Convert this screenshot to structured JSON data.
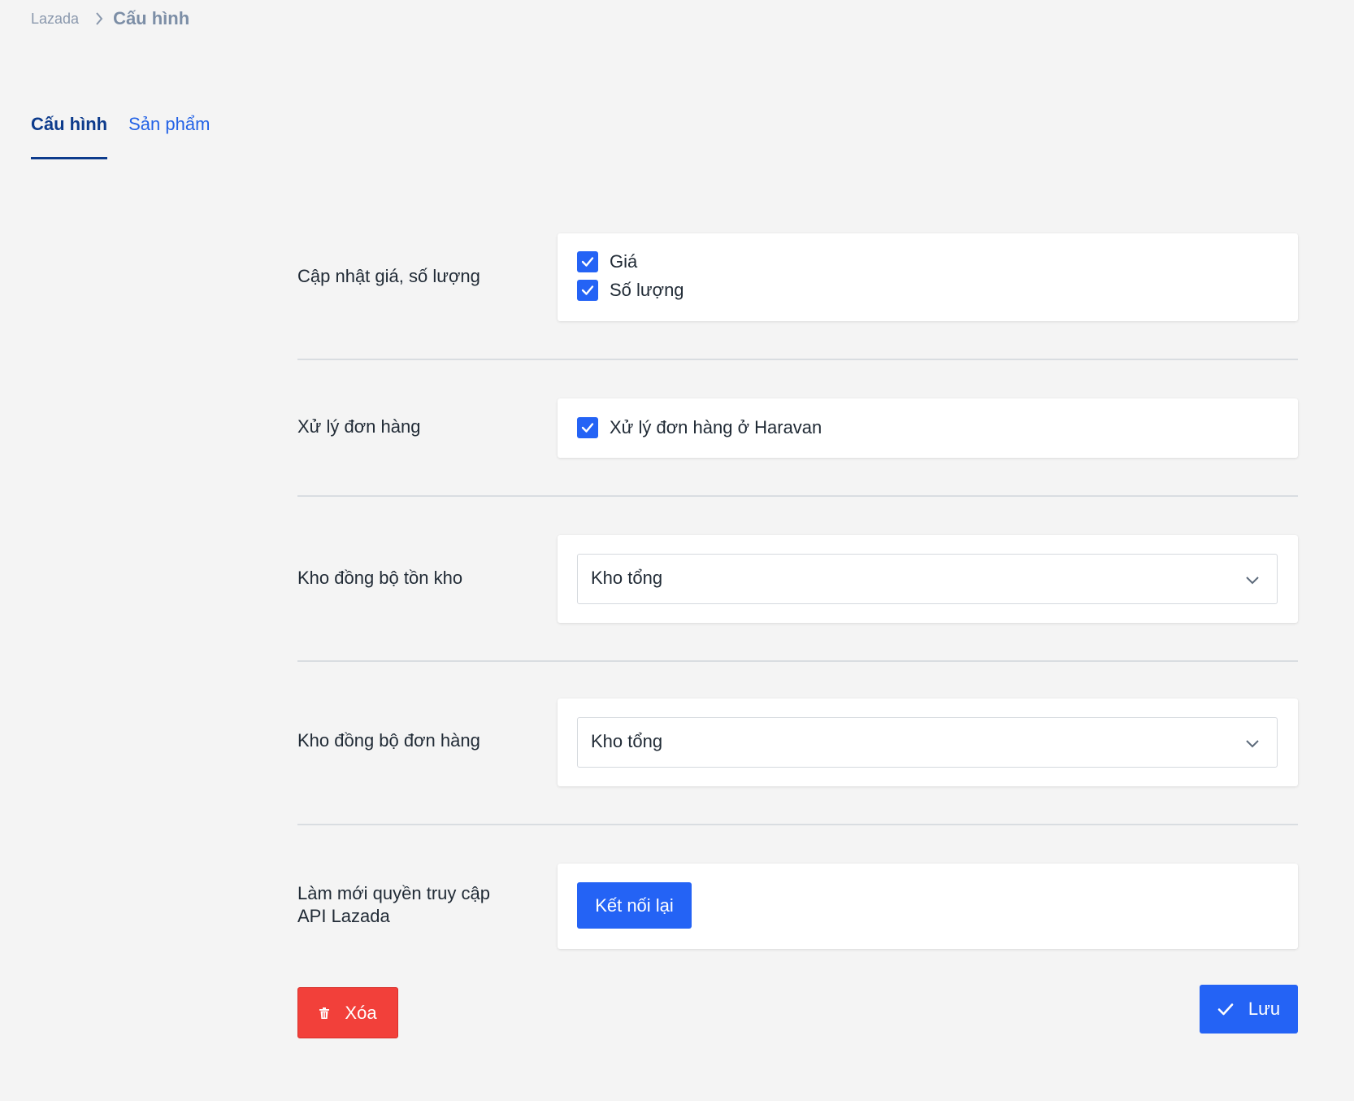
{
  "breadcrumb": {
    "root": "Lazada",
    "current": "Cấu hình"
  },
  "tabs": [
    {
      "label": "Cấu hình",
      "active": true
    },
    {
      "label": "Sản phẩm",
      "active": false
    }
  ],
  "sections": {
    "update_price_qty": {
      "label": "Cập nhật giá, số lượng",
      "options": [
        {
          "label": "Giá",
          "checked": true
        },
        {
          "label": "Số lượng",
          "checked": true
        }
      ]
    },
    "order_processing": {
      "label": "Xử lý đơn hàng",
      "options": [
        {
          "label": "Xử lý đơn hàng ở Haravan",
          "checked": true
        }
      ]
    },
    "inventory_warehouse": {
      "label": "Kho đồng bộ tồn kho",
      "selected": "Kho tổng"
    },
    "order_warehouse": {
      "label": "Kho đồng bộ đơn hàng",
      "selected": "Kho tổng"
    },
    "refresh_access": {
      "label_line1": "Làm mới quyền truy cập",
      "label_line2": "API Lazada",
      "button_label": "Kết nối lại"
    }
  },
  "actions": {
    "delete_label": "Xóa",
    "save_label": "Lưu"
  },
  "colors": {
    "background": "#f4f4f4",
    "primary": "#2463f5",
    "danger": "#f2403a",
    "active_tab": "#0d3b8c",
    "inactive_tab": "#2463e6"
  },
  "icons": {
    "breadcrumb_separator": "chevron-right-icon",
    "checkbox": "check-icon",
    "select": "chevron-down-icon",
    "delete": "trash-icon",
    "save": "check-icon"
  }
}
